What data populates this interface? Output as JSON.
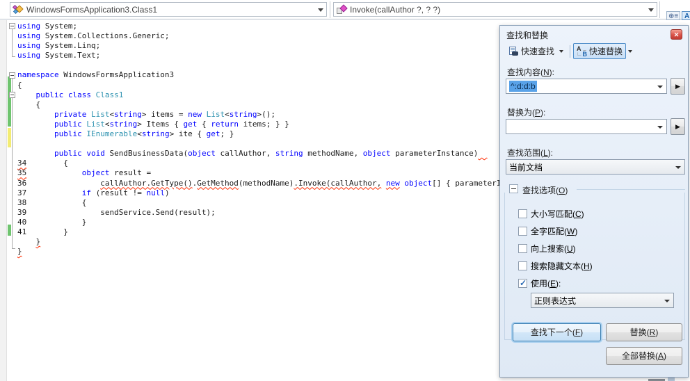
{
  "navbar": {
    "class_dropdown": "WindowsFormsApplication3.Class1",
    "member_dropdown": "Invoke(callAuthor ?, ? ?)"
  },
  "editor": {
    "lines": [
      {
        "fold": true,
        "segs": [
          [
            "k",
            "using"
          ],
          [
            "p",
            " System;"
          ]
        ]
      },
      {
        "segs": [
          [
            "k",
            "using"
          ],
          [
            "p",
            " System.Collections.Generic;"
          ]
        ]
      },
      {
        "segs": [
          [
            "k",
            "using"
          ],
          [
            "p",
            " System.Linq;"
          ]
        ]
      },
      {
        "segs": [
          [
            "k",
            "using"
          ],
          [
            "p",
            " System.Text;"
          ]
        ]
      },
      {
        "segs": []
      },
      {
        "fold": true,
        "segs": [
          [
            "k",
            "namespace"
          ],
          [
            "p",
            " WindowsFormsApplication3"
          ]
        ]
      },
      {
        "segs": [
          [
            "p",
            "{"
          ]
        ]
      },
      {
        "fold": true,
        "segs": [
          [
            "p",
            "    "
          ],
          [
            "k",
            "public"
          ],
          [
            "p",
            " "
          ],
          [
            "k",
            "class"
          ],
          [
            "p",
            " "
          ],
          [
            "t",
            "Class1"
          ]
        ]
      },
      {
        "segs": [
          [
            "p",
            "    {"
          ]
        ]
      },
      {
        "segs": [
          [
            "p",
            "        "
          ],
          [
            "k",
            "private"
          ],
          [
            "p",
            " "
          ],
          [
            "t",
            "List"
          ],
          [
            "p",
            "<"
          ],
          [
            "k",
            "string"
          ],
          [
            "p",
            "> items = "
          ],
          [
            "k",
            "new"
          ],
          [
            "p",
            " "
          ],
          [
            "t",
            "List"
          ],
          [
            "p",
            "<"
          ],
          [
            "k",
            "string"
          ],
          [
            "p",
            ">();"
          ]
        ]
      },
      {
        "segs": [
          [
            "p",
            "        "
          ],
          [
            "k",
            "public"
          ],
          [
            "p",
            " "
          ],
          [
            "t",
            "List"
          ],
          [
            "p",
            "<"
          ],
          [
            "k",
            "string"
          ],
          [
            "p",
            "> Items { "
          ],
          [
            "k",
            "get"
          ],
          [
            "p",
            " { "
          ],
          [
            "k",
            "return"
          ],
          [
            "p",
            " items; } }"
          ]
        ]
      },
      {
        "segs": [
          [
            "p",
            "        "
          ],
          [
            "k",
            "public"
          ],
          [
            "p",
            " "
          ],
          [
            "t",
            "IEnumerable"
          ],
          [
            "p",
            "<"
          ],
          [
            "k",
            "string"
          ],
          [
            "p",
            "> ite { "
          ],
          [
            "k",
            "get"
          ],
          [
            "p",
            "; }"
          ]
        ]
      },
      {
        "segs": []
      },
      {
        "segs": [
          [
            "p",
            "        "
          ],
          [
            "k",
            "public"
          ],
          [
            "p",
            " "
          ],
          [
            "k",
            "void"
          ],
          [
            "p",
            " SendBusinessData("
          ],
          [
            "k",
            "object"
          ],
          [
            "p",
            " callAuthor, "
          ],
          [
            "k",
            "string"
          ],
          [
            "p",
            " methodName, "
          ],
          [
            "k",
            "object"
          ],
          [
            "p",
            " parameterInstance)"
          ],
          [
            "e",
            "  "
          ]
        ]
      },
      {
        "segs": [
          [
            "e",
            "34"
          ],
          [
            "p",
            "        {"
          ]
        ]
      },
      {
        "segs": [
          [
            "e",
            "35"
          ],
          [
            "p",
            "            "
          ],
          [
            "k",
            "object"
          ],
          [
            "p",
            " result ="
          ]
        ]
      },
      {
        "segs": [
          [
            "p",
            "36                "
          ],
          [
            "e",
            "callAuthor.GetType()"
          ],
          [
            "p",
            "."
          ],
          [
            "e",
            "GetMethod"
          ],
          [
            "p",
            "(methodName)"
          ],
          [
            "e",
            ".Invoke(callAuthor,"
          ],
          [
            "p",
            " "
          ],
          [
            "ek",
            "new"
          ],
          [
            "p",
            " "
          ],
          [
            "k",
            "object"
          ],
          [
            "p",
            "[] { parameterInstance });"
          ]
        ]
      },
      {
        "segs": [
          [
            "p",
            "37            "
          ],
          [
            "k",
            "if"
          ],
          [
            "p",
            " (result != "
          ],
          [
            "k",
            "null"
          ],
          [
            "p",
            ")"
          ]
        ]
      },
      {
        "segs": [
          [
            "p",
            "38            {"
          ]
        ]
      },
      {
        "segs": [
          [
            "p",
            "39                sendService.Send(result);"
          ]
        ]
      },
      {
        "segs": [
          [
            "p",
            "40            }"
          ]
        ]
      },
      {
        "segs": [
          [
            "p",
            "41        }"
          ]
        ]
      },
      {
        "segs": [
          [
            "p",
            "    "
          ],
          [
            "e",
            "}"
          ]
        ]
      },
      {
        "segs": [
          [
            "e",
            "}"
          ]
        ]
      }
    ]
  },
  "dialog": {
    "title": "查找和替换",
    "toolbar": {
      "quick_find": "快速查找",
      "quick_replace": "快速替换"
    },
    "find_label": {
      "pre": "查找内容(",
      "key": "N",
      "suf": "):"
    },
    "find_value": "^:d:d:b",
    "replace_label": {
      "pre": "替换为(",
      "key": "P",
      "suf": "):"
    },
    "replace_value": "",
    "scope_label": {
      "pre": "查找范围(",
      "key": "L",
      "suf": "):"
    },
    "scope_value": "当前文档",
    "options_label": {
      "pre": "查找选项(",
      "key": "O",
      "suf": ")"
    },
    "checkboxes": [
      {
        "pre": "大小写匹配(",
        "key": "C",
        "suf": ")",
        "checked": false
      },
      {
        "pre": "全字匹配(",
        "key": "W",
        "suf": ")",
        "checked": false
      },
      {
        "pre": "向上搜索(",
        "key": "U",
        "suf": ")",
        "checked": false
      },
      {
        "pre": "搜索隐藏文本(",
        "key": "H",
        "suf": ")",
        "checked": false
      },
      {
        "pre": "使用(",
        "key": "E",
        "suf": "):",
        "checked": true
      }
    ],
    "use_value": "正则表达式",
    "buttons": {
      "find_next": {
        "pre": "查找下一个(",
        "key": "F",
        "suf": ")"
      },
      "replace": {
        "pre": "替换(",
        "key": "R",
        "suf": ")"
      },
      "replace_all": {
        "pre": "全部替换(",
        "key": "A",
        "suf": ")"
      }
    },
    "colors": {
      "accent_blue": "#4d8cc9",
      "selection": "#59a2e8",
      "change_saved_green": "#6fc46f",
      "change_unsaved_yellow": "#f3ec73",
      "error_squiggle_red": "#ff2a00"
    }
  }
}
